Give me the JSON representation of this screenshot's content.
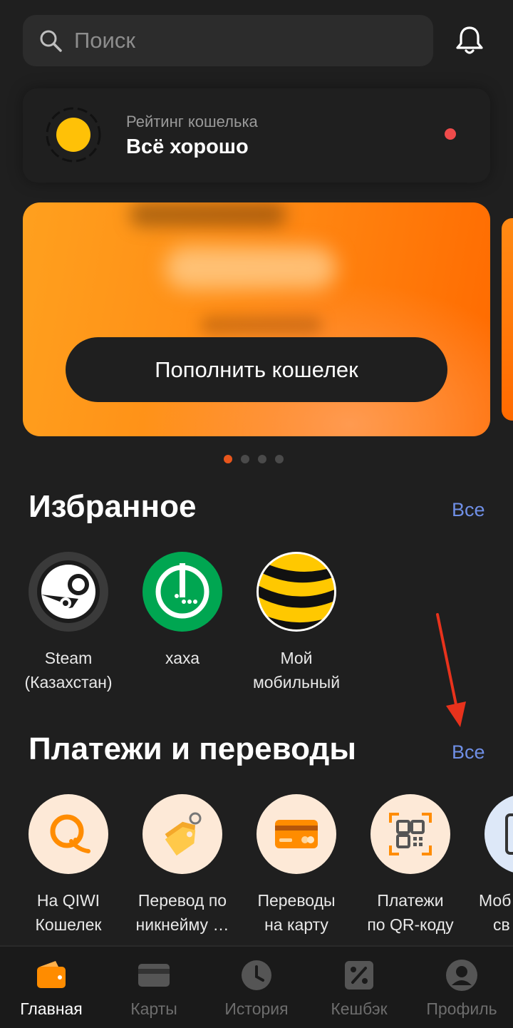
{
  "search": {
    "placeholder": "Поиск"
  },
  "rating": {
    "subtitle": "Рейтинг кошелька",
    "status": "Всё хорошо"
  },
  "balance_card": {
    "topup_label": "Пополнить кошелек",
    "page_count": 4,
    "active_page": 1
  },
  "favorites": {
    "title": "Избранное",
    "all_label": "Все",
    "items": [
      {
        "label": "Steam (Казахстан)",
        "icon": "steam-icon"
      },
      {
        "label": "хаха",
        "icon": "megafon-icon"
      },
      {
        "label": "Мой мобильный",
        "icon": "beeline-icon"
      }
    ]
  },
  "payments": {
    "title": "Платежи и переводы",
    "all_label": "Все",
    "items": [
      {
        "label_line1": "На QIWI",
        "label_line2": "Кошелек",
        "icon": "qiwi-icon"
      },
      {
        "label_line1": "Перевод по",
        "label_line2": "никнейму …",
        "icon": "tag-icon"
      },
      {
        "label_line1": "Переводы",
        "label_line2": "на карту",
        "icon": "card-icon"
      },
      {
        "label_line1": "Платежи",
        "label_line2": "по QR-коду",
        "icon": "qr-icon"
      },
      {
        "label_line1": "Моб",
        "label_line2": "св",
        "icon": "phone-icon"
      }
    ]
  },
  "nav": {
    "items": [
      {
        "label": "Главная",
        "icon": "wallet-icon",
        "active": true
      },
      {
        "label": "Карты",
        "icon": "cards-icon",
        "active": false
      },
      {
        "label": "История",
        "icon": "clock-icon",
        "active": false
      },
      {
        "label": "Кешбэк",
        "icon": "percent-icon",
        "active": false
      },
      {
        "label": "Профиль",
        "icon": "profile-icon",
        "active": false
      }
    ]
  },
  "colors": {
    "background": "#1f1f1f",
    "accent_orange": "#ff8a14",
    "link_blue": "#6f8fe6",
    "notification_red": "#ef4b4b"
  }
}
